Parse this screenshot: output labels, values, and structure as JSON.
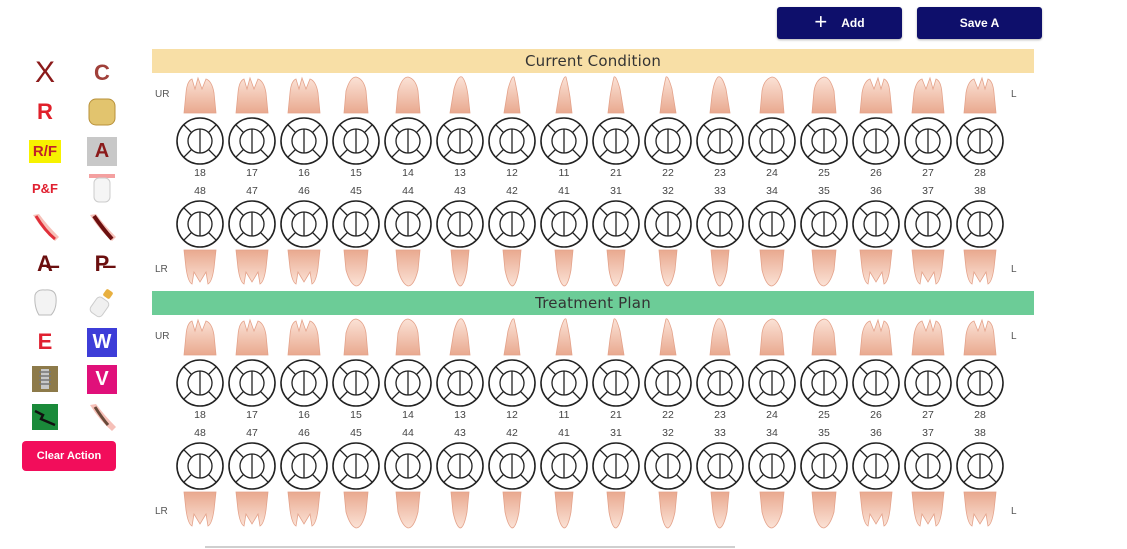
{
  "header": {
    "add_label": "Add",
    "save_label": "Save A"
  },
  "tools": [
    {
      "name": "extraction-tool",
      "text": "X",
      "color": "#8b1a1a"
    },
    {
      "name": "crown-letter-tool",
      "text": "C",
      "color": "#a0403a"
    },
    {
      "name": "restoration-tool",
      "text": "R",
      "color": "#e0202a"
    },
    {
      "name": "crown-tool",
      "text": "",
      "color": "#d8b25a"
    },
    {
      "name": "restoration-filling-tool",
      "text": "R/F",
      "color": "#c0202a",
      "bg": "#f7f200"
    },
    {
      "name": "amalgam-tool",
      "text": "A",
      "color": "#8b1a1a",
      "bg": "#c8c8c8"
    },
    {
      "name": "pit-fissure-tool",
      "text": "P&F",
      "color": "#e02030"
    },
    {
      "name": "veneer-tool",
      "text": "",
      "color": "#f4a0a0"
    },
    {
      "name": "root-canal-tool",
      "text": "",
      "color": "#e0303a"
    },
    {
      "name": "root-canal-dark-tool",
      "text": "",
      "color": "#6b0f0f"
    },
    {
      "name": "missing-anterior-tool",
      "text": "A̶",
      "color": "#6b0f0f"
    },
    {
      "name": "missing-posterior-tool",
      "text": "P̶",
      "color": "#6b0f0f"
    },
    {
      "name": "tooth-outline-tool",
      "text": "",
      "color": "#cccccc"
    },
    {
      "name": "bottle-tool",
      "text": "",
      "color": "#d9a040"
    },
    {
      "name": "erupting-tool",
      "text": "E",
      "color": "#e02030"
    },
    {
      "name": "wear-tool",
      "text": "W",
      "color": "#ffffff",
      "bg": "#3d3dd8"
    },
    {
      "name": "implant-tool",
      "text": "",
      "color": "#8a7a50"
    },
    {
      "name": "veneer-letter-tool",
      "text": "V",
      "color": "#ffffff",
      "bg": "#e0107a"
    },
    {
      "name": "fracture-tool",
      "text": "",
      "color": "#1a8a3a"
    },
    {
      "name": "root-canal-partial-tool",
      "text": "",
      "color": "#7a4a3a"
    }
  ],
  "clear_action_label": "Clear Action",
  "sections": [
    {
      "title": "Current Condition",
      "color": "#f8dfa6"
    },
    {
      "title": "Treatment Plan",
      "color": "#6ccc97"
    }
  ],
  "quadrants": {
    "ur": "UR",
    "lr": "LR",
    "ul": "L",
    "ll": "L"
  },
  "upper_teeth": [
    "18",
    "17",
    "16",
    "15",
    "14",
    "13",
    "12",
    "11",
    "21",
    "22",
    "23",
    "24",
    "25",
    "26",
    "27",
    "28"
  ],
  "lower_teeth": [
    "48",
    "47",
    "46",
    "45",
    "44",
    "43",
    "42",
    "41",
    "31",
    "32",
    "33",
    "34",
    "35",
    "36",
    "37",
    "38"
  ]
}
